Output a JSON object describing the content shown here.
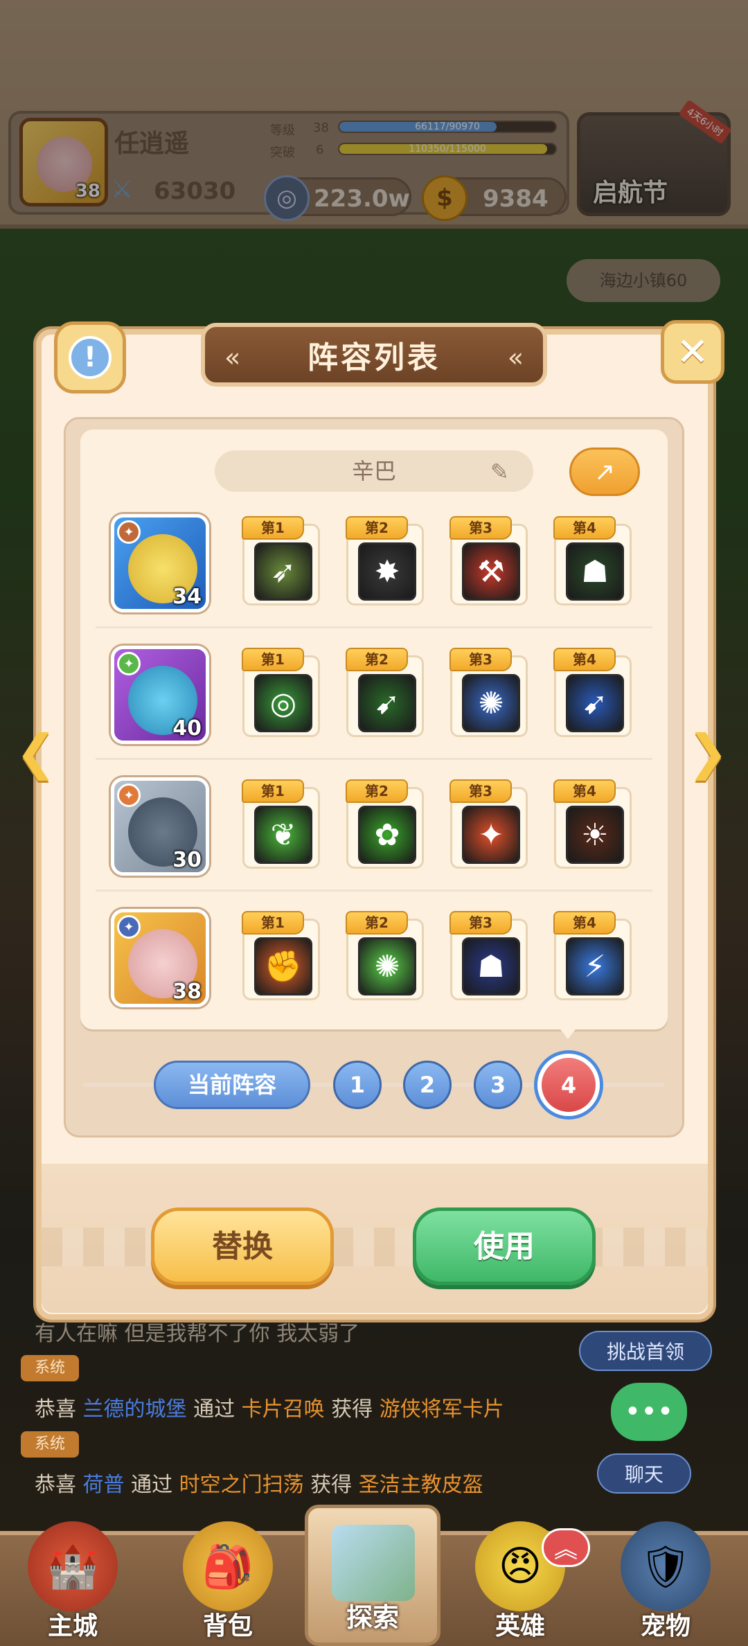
{
  "hud": {
    "player_name": "任逍遥",
    "avatar_level": "38",
    "power": "63030",
    "level_label": "等级",
    "level_value": "38",
    "exp_text": "66117/90970",
    "exp_fraction": 0.727,
    "break_label": "突破",
    "break_value": "6",
    "break_text": "110350/115000",
    "break_fraction": 0.96,
    "silver": "223.0w",
    "gold": "9384",
    "event_name": "启航节",
    "event_timer": "4天6小时",
    "location": "海边小镇60"
  },
  "modal": {
    "title": "阵容列表",
    "lineup_name": "辛巴",
    "current_label": "当前阵容",
    "tabs": [
      "1",
      "2",
      "3",
      "4"
    ],
    "active_tab": "4",
    "replace_label": "替换",
    "use_label": "使用"
  },
  "lineup": [
    {
      "level": "34",
      "badge_icon": "swords-icon",
      "skills": [
        {
          "tag": "第1",
          "icon": "arrows-icon"
        },
        {
          "tag": "第2",
          "icon": "rock-burst-icon"
        },
        {
          "tag": "第3",
          "icon": "axe-icon"
        },
        {
          "tag": "第4",
          "icon": "dark-totem-icon"
        }
      ]
    },
    {
      "level": "40",
      "badge_icon": "leaf-swirl-icon",
      "skills": [
        {
          "tag": "第1",
          "icon": "target-icon"
        },
        {
          "tag": "第2",
          "icon": "spear-strike-icon"
        },
        {
          "tag": "第3",
          "icon": "water-splash-icon"
        },
        {
          "tag": "第4",
          "icon": "ice-spear-icon"
        }
      ]
    },
    {
      "level": "30",
      "badge_icon": "paw-icon",
      "skills": [
        {
          "tag": "第1",
          "icon": "leaf-icon"
        },
        {
          "tag": "第2",
          "icon": "maple-leaf-icon"
        },
        {
          "tag": "第3",
          "icon": "paw-claw-icon"
        },
        {
          "tag": "第4",
          "icon": "fire-beast-icon"
        }
      ]
    },
    {
      "level": "38",
      "badge_icon": "anchor-icon",
      "skills": [
        {
          "tag": "第1",
          "icon": "fist-icon"
        },
        {
          "tag": "第2",
          "icon": "green-burst-icon"
        },
        {
          "tag": "第3",
          "icon": "mask-icon"
        },
        {
          "tag": "第4",
          "icon": "lightning-icon"
        }
      ]
    }
  ],
  "chat": {
    "partial_line": "有人在嘛 但是我帮不了你 我太弱了",
    "system_tag": "系统",
    "line1": {
      "a": "恭喜",
      "name": "兰德的城堡",
      "b": "通过",
      "source": "卡片召唤",
      "c": "获得",
      "item": "游侠将军卡片"
    },
    "line2": {
      "a": "恭喜",
      "name": "荷普",
      "b": "通过",
      "source": "时空之门扫荡",
      "c": "获得",
      "item": "圣洁主教皮盔"
    },
    "challenge_btn": "挑战首领",
    "chat_btn": "聊天"
  },
  "nav": {
    "items": [
      "主城",
      "背包",
      "探索",
      "英雄",
      "宠物"
    ]
  },
  "colors": {
    "accent_blue": "#5d8fd8",
    "active_red": "#d94848",
    "use_green": "#3fb868",
    "replace_yellow": "#f7bf4a"
  }
}
